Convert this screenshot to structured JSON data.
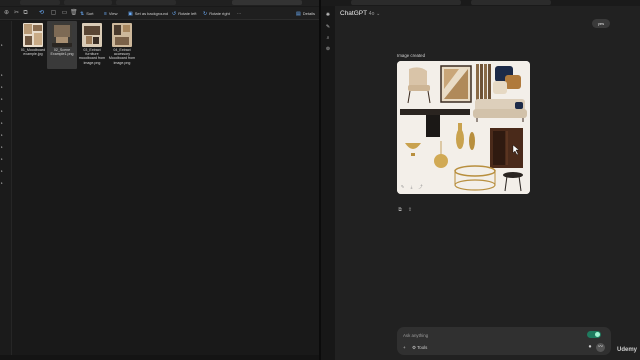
{
  "explorer": {
    "toolbar": {
      "sort": "Sort",
      "view": "View",
      "set_background": "Set as background",
      "rotate_left": "Rotate left",
      "rotate_right": "Rotate right",
      "more": "···",
      "details": "Details"
    },
    "files": [
      {
        "name": "01_Moodboard example.jpg",
        "selected": false
      },
      {
        "name": "02_Scene Example1.png",
        "selected": true
      },
      {
        "name": "03_Extract furniture moodboard from image.png",
        "selected": false
      },
      {
        "name": "04_Extract accessory Moodboard from image.png",
        "selected": false
      }
    ]
  },
  "chat": {
    "model": "ChatGPT",
    "model_version": "4o",
    "user_message": "yes",
    "image_label": "Image created",
    "composer": {
      "placeholder": "Ask anything",
      "tools_label": "Tools"
    }
  },
  "watermark": "Udemy",
  "colors": {
    "explorer_bg": "#191919",
    "chat_bg": "#212121",
    "accent": "#6db0ff",
    "toggle": "#1e7a5e"
  }
}
